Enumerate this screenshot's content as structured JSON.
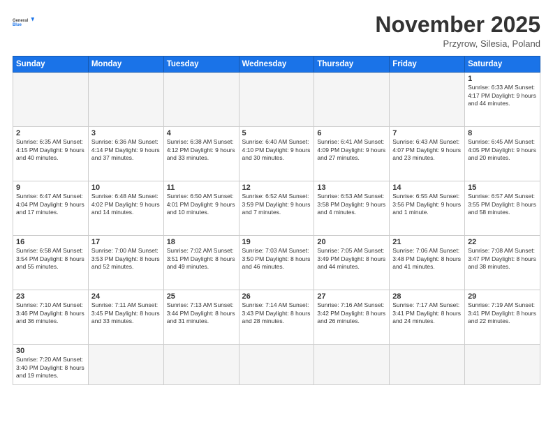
{
  "header": {
    "logo_general": "General",
    "logo_blue": "Blue",
    "month_title": "November 2025",
    "location": "Przyrow, Silesia, Poland"
  },
  "weekdays": [
    "Sunday",
    "Monday",
    "Tuesday",
    "Wednesday",
    "Thursday",
    "Friday",
    "Saturday"
  ],
  "weeks": [
    [
      {
        "day": "",
        "info": "",
        "empty": true
      },
      {
        "day": "",
        "info": "",
        "empty": true
      },
      {
        "day": "",
        "info": "",
        "empty": true
      },
      {
        "day": "",
        "info": "",
        "empty": true
      },
      {
        "day": "",
        "info": "",
        "empty": true
      },
      {
        "day": "",
        "info": "",
        "empty": true
      },
      {
        "day": "1",
        "info": "Sunrise: 6:33 AM\nSunset: 4:17 PM\nDaylight: 9 hours\nand 44 minutes."
      }
    ],
    [
      {
        "day": "2",
        "info": "Sunrise: 6:35 AM\nSunset: 4:15 PM\nDaylight: 9 hours\nand 40 minutes."
      },
      {
        "day": "3",
        "info": "Sunrise: 6:36 AM\nSunset: 4:14 PM\nDaylight: 9 hours\nand 37 minutes."
      },
      {
        "day": "4",
        "info": "Sunrise: 6:38 AM\nSunset: 4:12 PM\nDaylight: 9 hours\nand 33 minutes."
      },
      {
        "day": "5",
        "info": "Sunrise: 6:40 AM\nSunset: 4:10 PM\nDaylight: 9 hours\nand 30 minutes."
      },
      {
        "day": "6",
        "info": "Sunrise: 6:41 AM\nSunset: 4:09 PM\nDaylight: 9 hours\nand 27 minutes."
      },
      {
        "day": "7",
        "info": "Sunrise: 6:43 AM\nSunset: 4:07 PM\nDaylight: 9 hours\nand 23 minutes."
      },
      {
        "day": "8",
        "info": "Sunrise: 6:45 AM\nSunset: 4:05 PM\nDaylight: 9 hours\nand 20 minutes."
      }
    ],
    [
      {
        "day": "9",
        "info": "Sunrise: 6:47 AM\nSunset: 4:04 PM\nDaylight: 9 hours\nand 17 minutes."
      },
      {
        "day": "10",
        "info": "Sunrise: 6:48 AM\nSunset: 4:02 PM\nDaylight: 9 hours\nand 14 minutes."
      },
      {
        "day": "11",
        "info": "Sunrise: 6:50 AM\nSunset: 4:01 PM\nDaylight: 9 hours\nand 10 minutes."
      },
      {
        "day": "12",
        "info": "Sunrise: 6:52 AM\nSunset: 3:59 PM\nDaylight: 9 hours\nand 7 minutes."
      },
      {
        "day": "13",
        "info": "Sunrise: 6:53 AM\nSunset: 3:58 PM\nDaylight: 9 hours\nand 4 minutes."
      },
      {
        "day": "14",
        "info": "Sunrise: 6:55 AM\nSunset: 3:56 PM\nDaylight: 9 hours\nand 1 minute."
      },
      {
        "day": "15",
        "info": "Sunrise: 6:57 AM\nSunset: 3:55 PM\nDaylight: 8 hours\nand 58 minutes."
      }
    ],
    [
      {
        "day": "16",
        "info": "Sunrise: 6:58 AM\nSunset: 3:54 PM\nDaylight: 8 hours\nand 55 minutes."
      },
      {
        "day": "17",
        "info": "Sunrise: 7:00 AM\nSunset: 3:53 PM\nDaylight: 8 hours\nand 52 minutes."
      },
      {
        "day": "18",
        "info": "Sunrise: 7:02 AM\nSunset: 3:51 PM\nDaylight: 8 hours\nand 49 minutes."
      },
      {
        "day": "19",
        "info": "Sunrise: 7:03 AM\nSunset: 3:50 PM\nDaylight: 8 hours\nand 46 minutes."
      },
      {
        "day": "20",
        "info": "Sunrise: 7:05 AM\nSunset: 3:49 PM\nDaylight: 8 hours\nand 44 minutes."
      },
      {
        "day": "21",
        "info": "Sunrise: 7:06 AM\nSunset: 3:48 PM\nDaylight: 8 hours\nand 41 minutes."
      },
      {
        "day": "22",
        "info": "Sunrise: 7:08 AM\nSunset: 3:47 PM\nDaylight: 8 hours\nand 38 minutes."
      }
    ],
    [
      {
        "day": "23",
        "info": "Sunrise: 7:10 AM\nSunset: 3:46 PM\nDaylight: 8 hours\nand 36 minutes."
      },
      {
        "day": "24",
        "info": "Sunrise: 7:11 AM\nSunset: 3:45 PM\nDaylight: 8 hours\nand 33 minutes."
      },
      {
        "day": "25",
        "info": "Sunrise: 7:13 AM\nSunset: 3:44 PM\nDaylight: 8 hours\nand 31 minutes."
      },
      {
        "day": "26",
        "info": "Sunrise: 7:14 AM\nSunset: 3:43 PM\nDaylight: 8 hours\nand 28 minutes."
      },
      {
        "day": "27",
        "info": "Sunrise: 7:16 AM\nSunset: 3:42 PM\nDaylight: 8 hours\nand 26 minutes."
      },
      {
        "day": "28",
        "info": "Sunrise: 7:17 AM\nSunset: 3:41 PM\nDaylight: 8 hours\nand 24 minutes."
      },
      {
        "day": "29",
        "info": "Sunrise: 7:19 AM\nSunset: 3:41 PM\nDaylight: 8 hours\nand 22 minutes."
      }
    ],
    [
      {
        "day": "30",
        "info": "Sunrise: 7:20 AM\nSunset: 3:40 PM\nDaylight: 8 hours\nand 19 minutes.",
        "lastrow": true
      },
      {
        "day": "",
        "info": "",
        "empty": true,
        "lastrow": true
      },
      {
        "day": "",
        "info": "",
        "empty": true,
        "lastrow": true
      },
      {
        "day": "",
        "info": "",
        "empty": true,
        "lastrow": true
      },
      {
        "day": "",
        "info": "",
        "empty": true,
        "lastrow": true
      },
      {
        "day": "",
        "info": "",
        "empty": true,
        "lastrow": true
      },
      {
        "day": "",
        "info": "",
        "empty": true,
        "lastrow": true
      }
    ]
  ]
}
